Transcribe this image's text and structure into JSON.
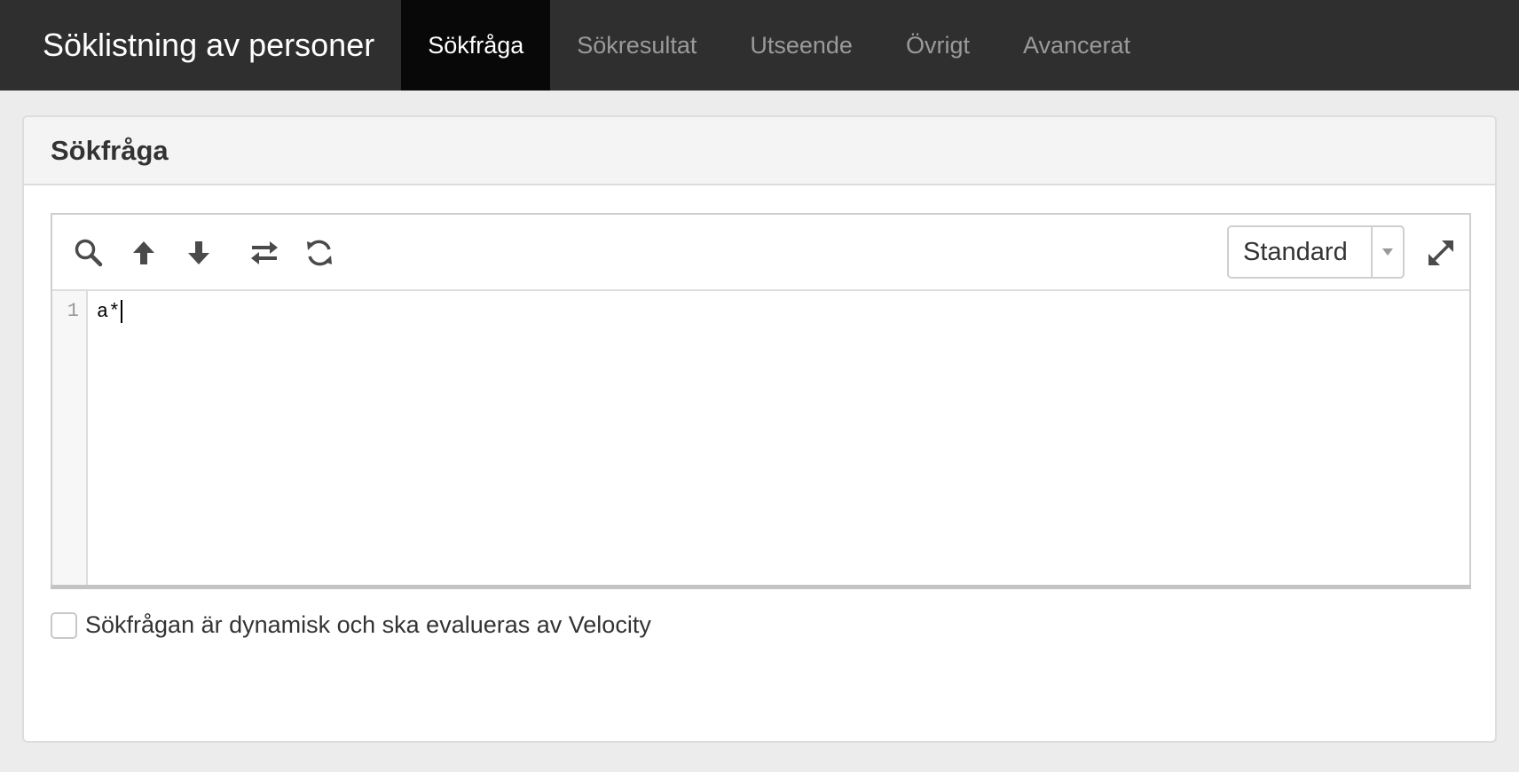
{
  "app": {
    "title": "Söklistning av personer"
  },
  "nav": {
    "tabs": [
      {
        "label": "Sökfråga",
        "active": true
      },
      {
        "label": "Sökresultat",
        "active": false
      },
      {
        "label": "Utseende",
        "active": false
      },
      {
        "label": "Övrigt",
        "active": false
      },
      {
        "label": "Avancerat",
        "active": false
      }
    ]
  },
  "panel": {
    "title": "Sökfråga"
  },
  "editor": {
    "toolbar": {
      "icons": [
        "search-icon",
        "arrow-up-icon",
        "arrow-down-icon",
        "swap-icon",
        "refresh-icon"
      ],
      "mode_select": {
        "value": "Standard"
      },
      "expand_icon": "expand-icon"
    },
    "lines": [
      {
        "number": "1",
        "text": "a*"
      }
    ]
  },
  "options": {
    "dynamic_checkbox": {
      "label": "Sökfrågan är dynamisk och ska evalueras av Velocity",
      "checked": false
    }
  },
  "colors": {
    "topbar": "#2f2f2f",
    "active_tab": "#080808",
    "inactive_tab_text": "#9a9a9a",
    "page_background": "#ececec",
    "icon": "#4a4a4a"
  }
}
